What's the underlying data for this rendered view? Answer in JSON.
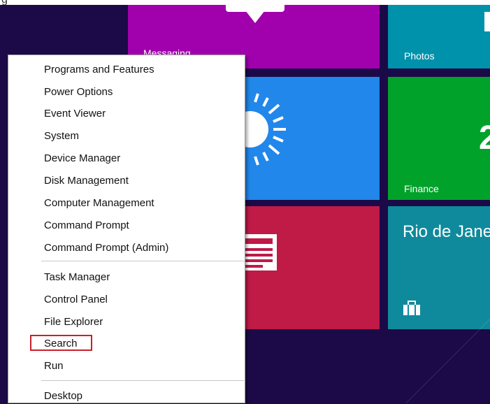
{
  "header": {
    "app_label_fragment": "g"
  },
  "tiles": {
    "messaging": {
      "label": "Messaging",
      "color": "#a100ad",
      "icon": "speech-bubble-icon"
    },
    "photos": {
      "label": "Photos",
      "color": "#0091ab",
      "icon": "photo-icon"
    },
    "weather": {
      "color": "#2187ea",
      "icon": "sun-icon"
    },
    "finance": {
      "label": "Finance",
      "color": "#00a22a",
      "icon": "chart-icon"
    },
    "news": {
      "color": "#c01a47",
      "icon": "newspaper-icon"
    },
    "travel": {
      "label": "Rio de Janeiro",
      "color": "#0f8a9c",
      "icon": "suitcase-icon"
    }
  },
  "context_menu": {
    "group1": [
      "Programs and Features",
      "Power Options",
      "Event Viewer",
      "System",
      "Device Manager",
      "Disk Management",
      "Computer Management",
      "Command Prompt",
      "Command Prompt (Admin)"
    ],
    "group2": [
      "Task Manager",
      "Control Panel",
      "File Explorer",
      "Search",
      "Run"
    ],
    "group3": [
      "Desktop"
    ],
    "highlighted_item": "Search",
    "highlight_color": "#c8202c"
  }
}
